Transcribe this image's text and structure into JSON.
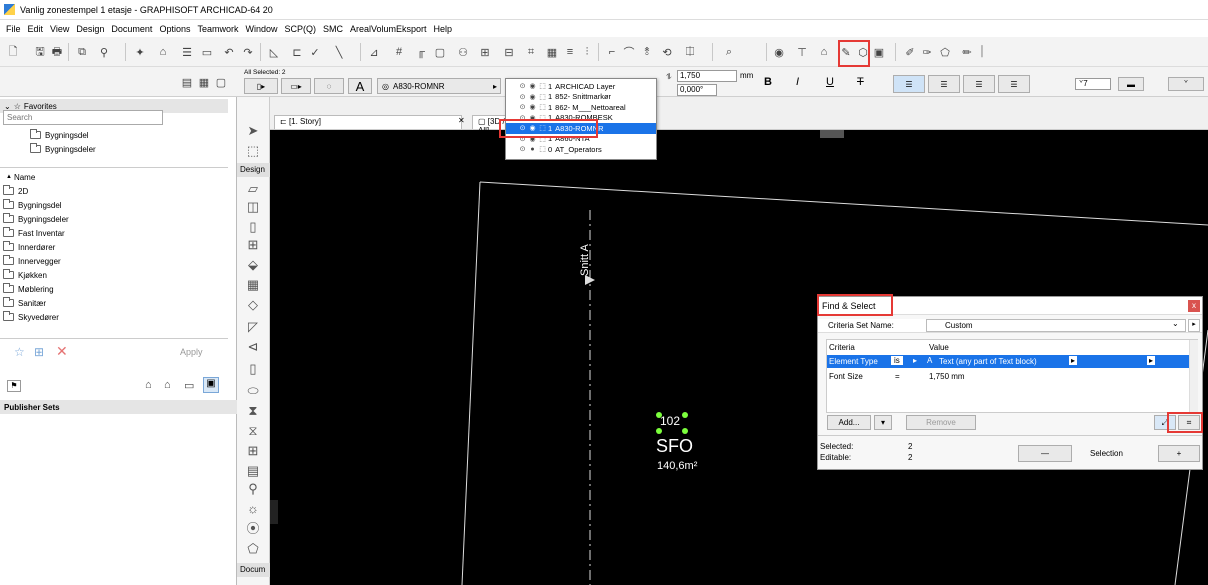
{
  "window": {
    "title": "Vanlig zonestempel 1 etasje - GRAPHISOFT ARCHICAD-64 20"
  },
  "menu": [
    "File",
    "Edit",
    "View",
    "Design",
    "Document",
    "Options",
    "Teamwork",
    "Window",
    "SCP(Q)",
    "SMC",
    "ArealVolumEksport",
    "Help"
  ],
  "info_box": {
    "all_selected": "All Selected: 2",
    "layer": "A830-ROMNR",
    "height_value": "1,750",
    "height_unit": "mm",
    "angle_value": "0,000°",
    "bold": "B",
    "italic": "I",
    "underline": "U",
    "strike": "T",
    "pen": "7"
  },
  "left_panel": {
    "search_placeholder": "Search",
    "favorites_label": "Favorites",
    "favorites": [
      "2D",
      "Bygningsdel",
      "Bygningsdeler"
    ],
    "name_header": "Name",
    "names": [
      "2D",
      "Bygningsdel",
      "Bygningsdeler",
      "Fast Inventar",
      "Innerdører",
      "Innervegger",
      "Kjøkken",
      "Møblering",
      "Sanitær",
      "Skyvedører"
    ],
    "apply_label": "Apply",
    "publisher_sets": "Publisher Sets"
  },
  "toolbox": {
    "design_label": "Design",
    "docum_label": "Docum"
  },
  "tabs": [
    "[1. Story]",
    "[3D / All]"
  ],
  "layer_popup": {
    "items": [
      {
        "num": "1",
        "name": "ARCHICAD Layer"
      },
      {
        "num": "1",
        "name": "852- Snittmarkør"
      },
      {
        "num": "1",
        "name": "862- M___Nettoareal"
      },
      {
        "num": "1",
        "name": "A830-ROMBESK"
      },
      {
        "num": "1",
        "name": "A830-ROMNR"
      },
      {
        "num": "1",
        "name": "A860-NTA"
      },
      {
        "num": "0",
        "name": "AT_Operators"
      }
    ],
    "selected_index": 4
  },
  "canvas": {
    "section_label": "Snitt A",
    "zone_number": "102",
    "zone_name": "SFO",
    "zone_area": "140,6m²"
  },
  "find_select": {
    "title": "Find & Select",
    "criteria_set_label": "Criteria Set Name:",
    "criteria_set_value": "Custom",
    "col_criteria": "Criteria",
    "col_value": "Value",
    "rows": [
      {
        "criteria": "Element Type",
        "op": "is",
        "value": "Text (any part of Text block)"
      },
      {
        "criteria": "Font Size",
        "op": "=",
        "value": "1,750 mm"
      }
    ],
    "add_label": "Add...",
    "remove_label": "Remove",
    "selected_label": "Selected:",
    "selected_value": "2",
    "editable_label": "Editable:",
    "editable_value": "2",
    "minus_label": "—",
    "selection_label": "Selection",
    "plus_label": "+",
    "close_label": "x"
  },
  "colors": {
    "highlight": "#1a73e8",
    "annotation": "#e53935",
    "canvas": "#000000"
  }
}
